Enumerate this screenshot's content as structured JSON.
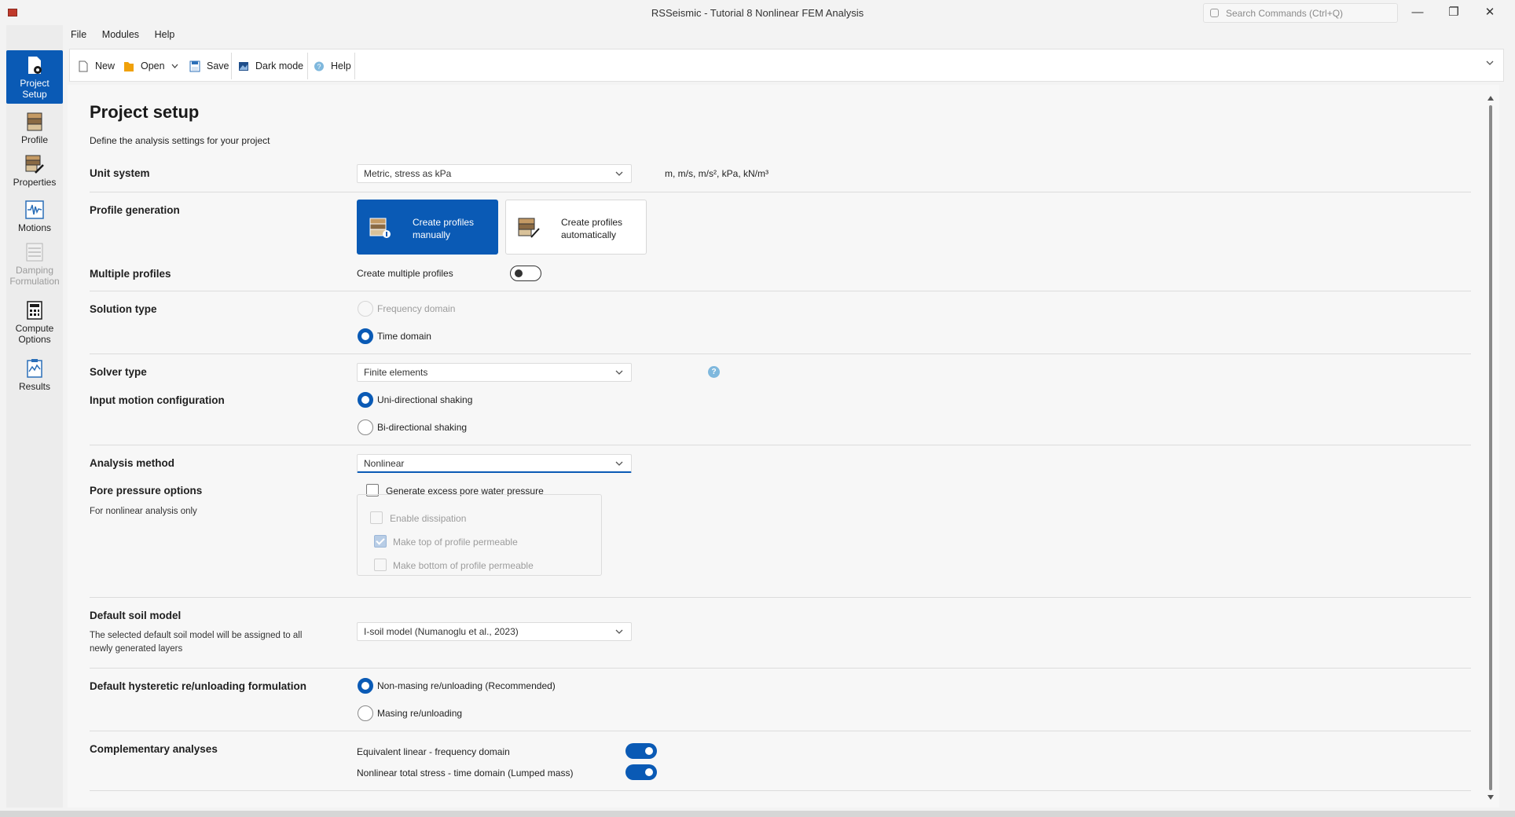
{
  "window": {
    "title": "RSSeismic - Tutorial 8 Nonlinear FEM Analysis",
    "search_placeholder": "Search Commands (Ctrl+Q)",
    "minimize": "—",
    "maximize": "❐",
    "close": "✕"
  },
  "menu": [
    "File",
    "Modules",
    "Help"
  ],
  "toolbar": {
    "new": "New",
    "open": "Open",
    "save": "Save",
    "dark_mode": "Dark mode",
    "help": "Help"
  },
  "leftnav": [
    {
      "label": "Project Setup",
      "active": true
    },
    {
      "label": "Profile"
    },
    {
      "label": "Properties"
    },
    {
      "label": "Motions"
    },
    {
      "label": "Damping Formulation",
      "disabled": true
    },
    {
      "label": "Compute Options"
    },
    {
      "label": "Results"
    }
  ],
  "page": {
    "title": "Project setup",
    "subtitle": "Define the analysis settings for your project"
  },
  "unit_system": {
    "label": "Unit system",
    "value": "Metric, stress as kPa",
    "units": "m, m/s, m/s², kPa, kN/m³"
  },
  "profile_generation": {
    "label": "Profile generation",
    "manual": "Create profiles manually",
    "automatic": "Create profiles automatically",
    "selected": "manual"
  },
  "multiple_profiles": {
    "label": "Multiple profiles",
    "toggle_label": "Create multiple profiles",
    "enabled": false
  },
  "solution_type": {
    "label": "Solution type",
    "options": [
      "Frequency domain",
      "Time domain"
    ],
    "selected": "Time domain"
  },
  "solver_type": {
    "label": "Solver type",
    "value": "Finite elements",
    "help": "?"
  },
  "input_motion": {
    "label": "Input motion configuration",
    "options": [
      "Uni-directional shaking",
      "Bi-directional shaking"
    ],
    "selected": "Uni-directional shaking"
  },
  "analysis_method": {
    "label": "Analysis method",
    "value": "Nonlinear"
  },
  "pore_pressure": {
    "label": "Pore pressure options",
    "sublabel": "For nonlinear analysis only",
    "generate": "Generate excess pore water pressure",
    "enable_dissipation": "Enable dissipation",
    "top_permeable": "Make top of profile permeable",
    "bottom_permeable": "Make bottom of profile permeable"
  },
  "default_soil_model": {
    "label": "Default soil model",
    "sublabel": "The selected default soil model will be assigned to all newly generated layers",
    "value": "I-soil model (Numanoglu et al., 2023)"
  },
  "hysteretic": {
    "label": "Default hysteretic re/unloading formulation",
    "options": [
      "Non-masing re/unloading (Recommended)",
      "Masing re/unloading"
    ],
    "selected": "Non-masing re/unloading (Recommended)"
  },
  "complementary": {
    "label": "Complementary analyses",
    "items": [
      {
        "label": "Equivalent linear - frequency domain",
        "enabled": true
      },
      {
        "label": "Nonlinear total stress - time domain (Lumped mass)",
        "enabled": true
      }
    ]
  },
  "colors": {
    "accent": "#0a5ab5",
    "help_icon": "#7fb8dd"
  }
}
